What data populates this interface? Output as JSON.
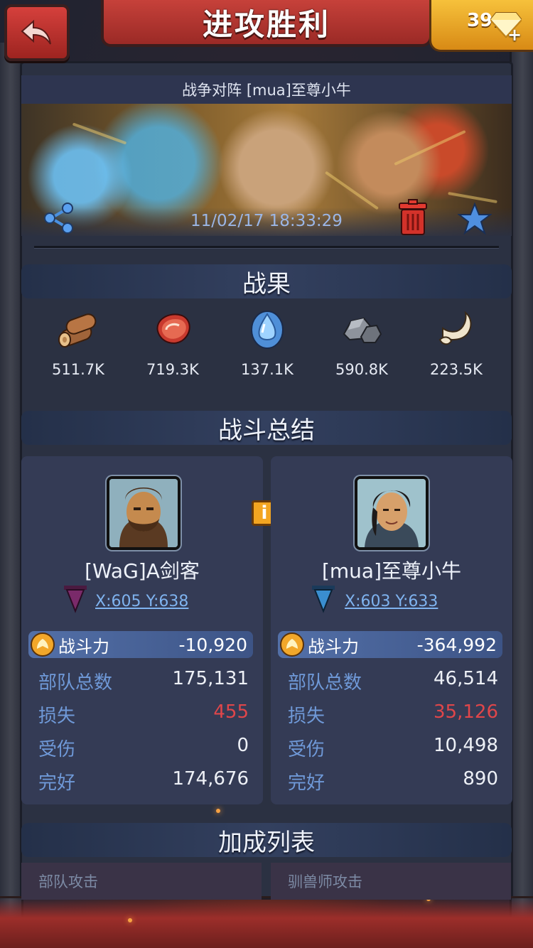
{
  "header": {
    "title": "进攻胜利",
    "gems": "391"
  },
  "battle": {
    "subtitle": "战争对阵 [mua]至尊小牛",
    "timestamp": "11/02/17 18:33:29"
  },
  "sections": {
    "rewards": "战果",
    "summary": "战斗总结",
    "bonus": "加成列表"
  },
  "rewards": [
    {
      "icon": "wood-icon",
      "value": "511.7K"
    },
    {
      "icon": "meat-icon",
      "value": "719.3K"
    },
    {
      "icon": "water-icon",
      "value": "137.1K"
    },
    {
      "icon": "stone-icon",
      "value": "590.8K"
    },
    {
      "icon": "bone-icon",
      "value": "223.5K"
    }
  ],
  "attacker": {
    "name": "[WaG]A剑客",
    "coords": "X:605 Y:638",
    "flag_color": "#7a2a6a",
    "power_label": "战斗力",
    "power": "-10,920",
    "stats": [
      {
        "label": "部队总数",
        "value": "175,131"
      },
      {
        "label": "损失",
        "value": "455"
      },
      {
        "label": "受伤",
        "value": "0"
      },
      {
        "label": "完好",
        "value": "174,676"
      }
    ]
  },
  "defender": {
    "name": "[mua]至尊小牛",
    "coords": "X:603 Y:633",
    "flag_color": "#3a8ed0",
    "power_label": "战斗力",
    "power": "-364,992",
    "stats": [
      {
        "label": "部队总数",
        "value": "46,514"
      },
      {
        "label": "损失",
        "value": "35,126"
      },
      {
        "label": "受伤",
        "value": "10,498"
      },
      {
        "label": "完好",
        "value": "890"
      }
    ]
  },
  "bonus_list": {
    "left": "部队攻击",
    "right": "驯兽师攻击"
  },
  "colors": {
    "loss": "#e0464a",
    "label": "#6f99d8",
    "accent_red": "#c6413a",
    "gem_gold": "#f6c13b"
  }
}
